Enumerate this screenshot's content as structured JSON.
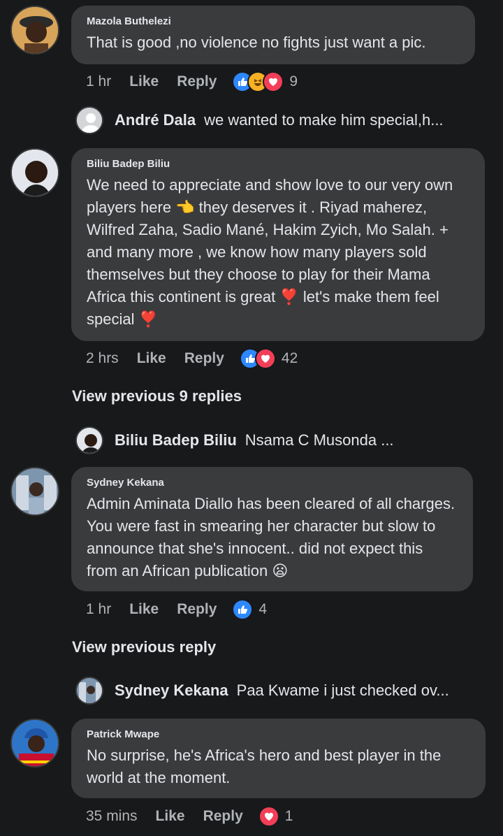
{
  "comments": [
    {
      "author": "Mazola Buthelezi",
      "text": "That is good ,no violence no fights just want a pic.",
      "time": "1 hr",
      "like_label": "Like",
      "reply_label": "Reply",
      "reaction_count": "9",
      "reactions": [
        "like-reaction-icon",
        "haha-reaction-icon",
        "love-reaction-icon"
      ]
    },
    {
      "author": "Biliu Badep Biliu",
      "text": "We need to appreciate and show love to our very own players here 👈 they deserves it . Riyad maherez, Wilfred Zaha, Sadio Mané, Hakim  Zyich, Mo Salah. + and many more , we know how many players sold themselves but they choose to play for their Mama Africa this continent is great ❣️ let's make them feel special ❣️",
      "time": "2 hrs",
      "like_label": "Like",
      "reply_label": "Reply",
      "reaction_count": "42",
      "reactions": [
        "like-reaction-icon",
        "love-reaction-icon"
      ]
    },
    {
      "author": "Sydney Kekana",
      "text": "Admin Aminata Diallo has been cleared of all charges. You were fast in smearing her character but slow to announce that she's innocent.. did not expect this from an African publication 😦",
      "time": "1 hr",
      "like_label": "Like",
      "reply_label": "Reply",
      "reaction_count": "4",
      "reactions": [
        "like-reaction-icon"
      ]
    },
    {
      "author": "Patrick Mwape",
      "text": "No surprise, he's Africa's hero and best player in the world at the moment.",
      "time": "35 mins",
      "like_label": "Like",
      "reply_label": "Reply",
      "reaction_count": "1",
      "reactions": [
        "love-reaction-icon"
      ]
    }
  ],
  "replies": [
    {
      "author": "André Dala",
      "text": "we wanted to make him special,h..."
    },
    {
      "author": "Biliu Badep Biliu",
      "text": "Nsama C Musonda ..."
    },
    {
      "author": "Sydney Kekana",
      "text": "Paa Kwame i just checked  ov..."
    }
  ],
  "view_previous": [
    "View previous 9 replies",
    "View previous reply"
  ],
  "colors": {
    "background": "#18191a",
    "bubble": "#3a3b3c",
    "text": "#e4e6eb",
    "muted": "#b0b3b8",
    "like_blue": "#2d88ff",
    "love_red": "#f33e58",
    "haha_yellow": "#f7b125"
  }
}
